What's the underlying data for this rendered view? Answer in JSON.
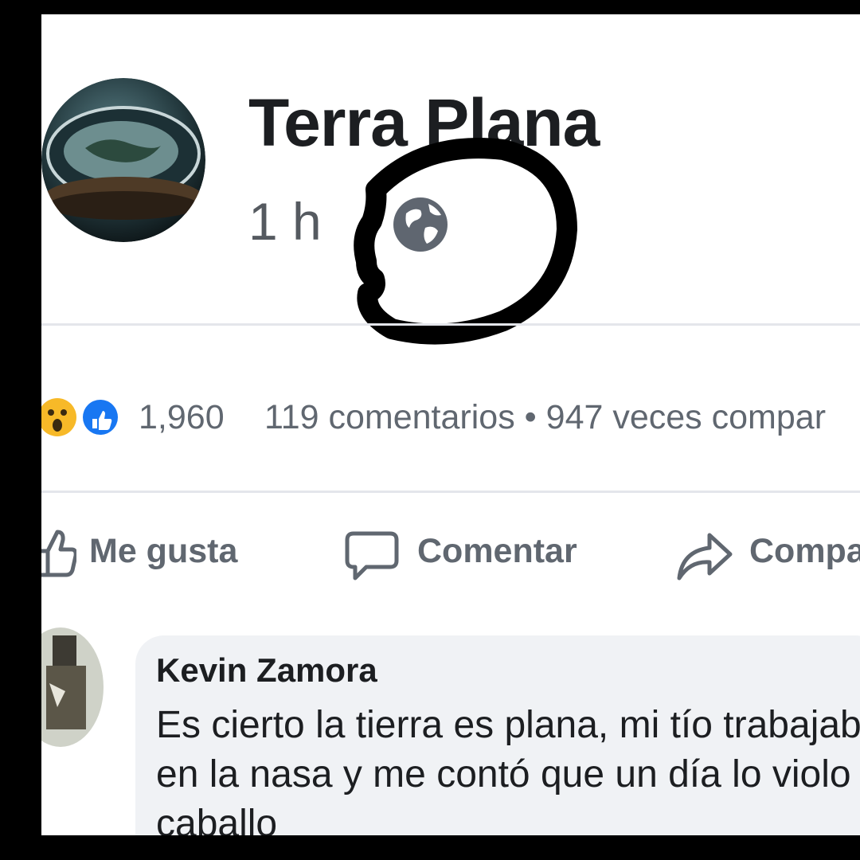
{
  "post": {
    "page_name": "Terra Plana",
    "time": "1 h",
    "privacy_icon": "globe-icon"
  },
  "stats": {
    "reactions": "1,960",
    "reaction_icons": [
      "wow-icon",
      "like-icon"
    ],
    "comments_shares": "119 comentarios • 947 veces compar"
  },
  "actions": {
    "like": "Me gusta",
    "comment": "Comentar",
    "share": "Compa"
  },
  "comment": {
    "author": "Kevin Zamora",
    "text": "Es cierto la tierra es plana, mi tío trabajaba en la nasa y me contó que un día lo violo un caballo"
  },
  "colors": {
    "background": "#ffffff",
    "text_primary": "#1c1e21",
    "text_secondary": "#606770",
    "like_blue": "#1877f2",
    "wow_yellow": "#f7b928",
    "annotation_black": "#000000"
  }
}
